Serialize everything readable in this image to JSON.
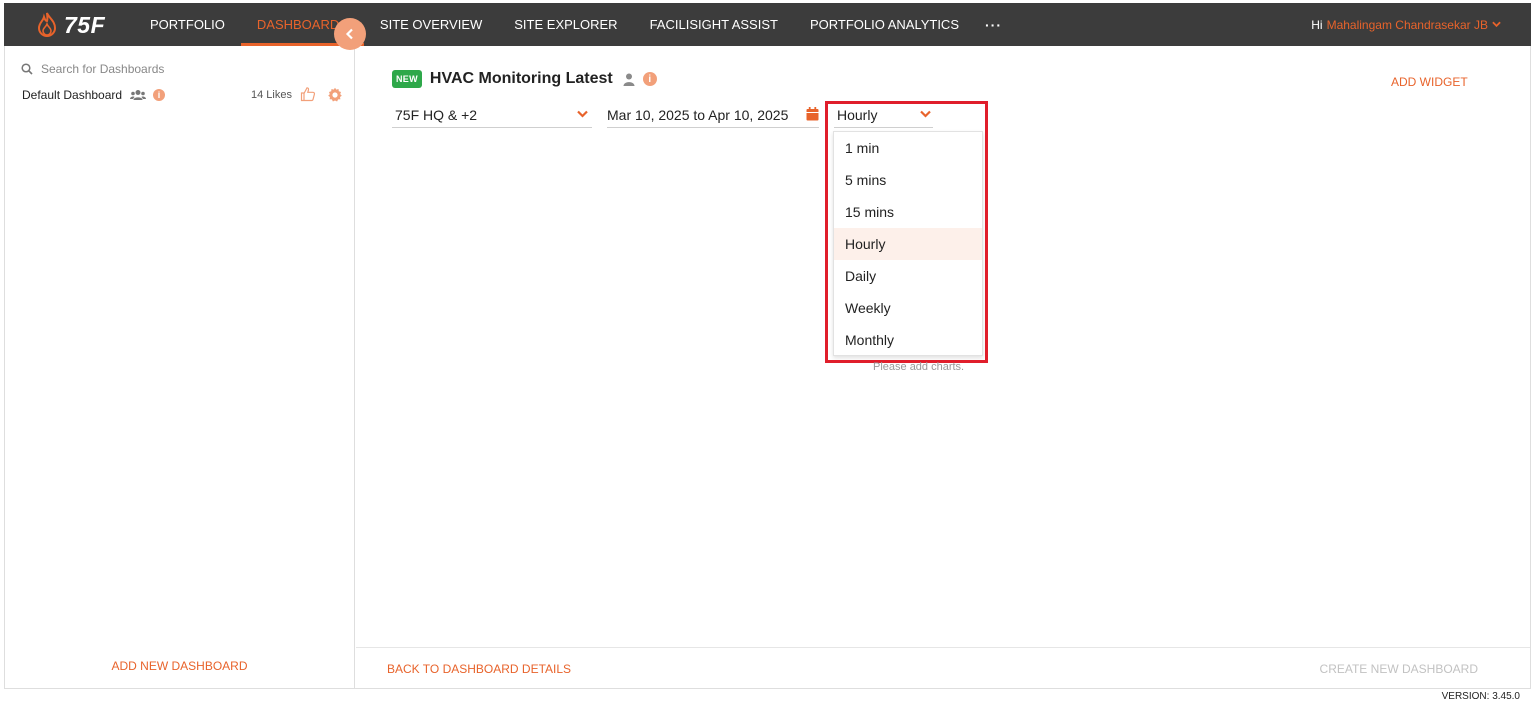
{
  "app": {
    "logo_text": "75F"
  },
  "nav": {
    "items": [
      {
        "label": "PORTFOLIO",
        "active": false
      },
      {
        "label": "DASHBOARDS",
        "active": true
      },
      {
        "label": "SITE OVERVIEW",
        "active": false
      },
      {
        "label": "SITE EXPLORER",
        "active": false
      },
      {
        "label": "FACILISIGHT ASSIST",
        "active": false
      },
      {
        "label": "PORTFOLIO ANALYTICS",
        "active": false
      }
    ],
    "more": "···"
  },
  "user": {
    "greeting": "Hi",
    "name": "Mahalingam Chandrasekar JB"
  },
  "sidebar": {
    "search_placeholder": "Search for Dashboards",
    "dashboard": {
      "name": "Default Dashboard",
      "likes": "14 Likes"
    },
    "add_label": "ADD NEW DASHBOARD"
  },
  "main": {
    "badge": "NEW",
    "title": "HVAC Monitoring Latest",
    "add_widget": "ADD WIDGET",
    "site_filter": "75F HQ & +2",
    "date_range": "Mar 10, 2025 to Apr 10, 2025",
    "interval": {
      "selected": "Hourly",
      "options": [
        "1 min",
        "5 mins",
        "15 mins",
        "Hourly",
        "Daily",
        "Weekly",
        "Monthly"
      ]
    },
    "empty_message": "Please add charts."
  },
  "footer": {
    "back_label": "BACK TO DASHBOARD DETAILS",
    "create_label": "CREATE NEW DASHBOARD",
    "version": "VERSION: 3.45.0"
  },
  "colors": {
    "accent": "#e8632b",
    "topbar": "#3c3c3c",
    "badge": "#2ea84a",
    "highlight": "#e01e2b"
  }
}
